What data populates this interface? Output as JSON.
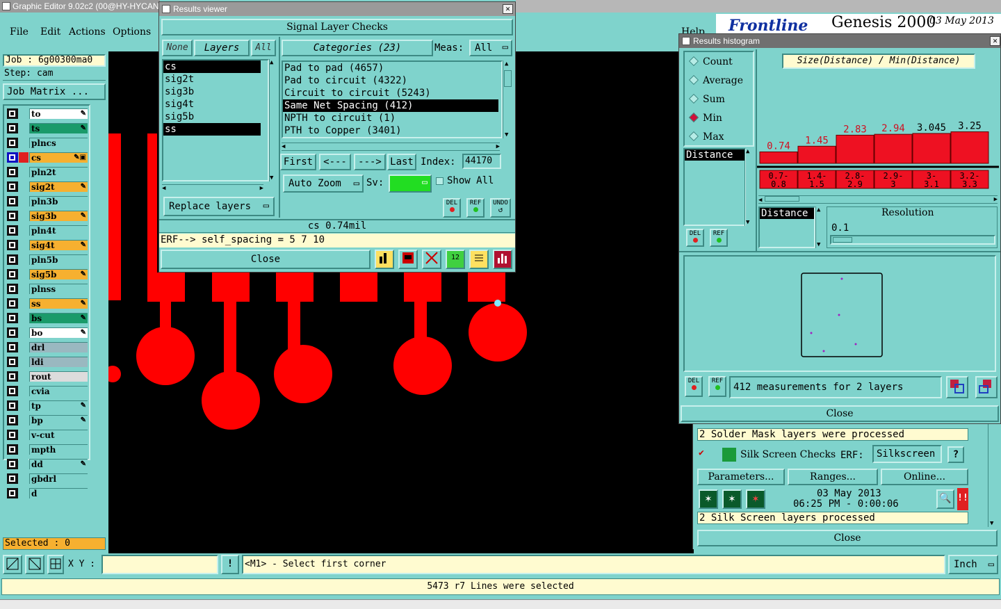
{
  "app": {
    "title": "Graphic Editor 9.02c2 (00@HY-HYCAN"
  },
  "menu": {
    "file": "File",
    "edit": "Edit",
    "actions": "Actions",
    "options": "Options"
  },
  "job": {
    "job_label": "Job : 6g00300ma0",
    "step_label": "Step: cam",
    "matrix_button": "Job Matrix ..."
  },
  "layers": [
    {
      "name": "to",
      "color": "#ffffff",
      "edit": true
    },
    {
      "name": "ts",
      "color": "#1a9a6a",
      "edit": true
    },
    {
      "name": "plncs",
      "color": "#7fd3cc",
      "edit": false
    },
    {
      "name": "cs",
      "color": "#f6b030",
      "edit": true,
      "active": true
    },
    {
      "name": "pln2t",
      "color": "#7fd3cc",
      "edit": false
    },
    {
      "name": "sig2t",
      "color": "#f6b030",
      "edit": true
    },
    {
      "name": "pln3b",
      "color": "#7fd3cc",
      "edit": false
    },
    {
      "name": "sig3b",
      "color": "#f6b030",
      "edit": true
    },
    {
      "name": "pln4t",
      "color": "#7fd3cc",
      "edit": false
    },
    {
      "name": "sig4t",
      "color": "#f6b030",
      "edit": true
    },
    {
      "name": "pln5b",
      "color": "#7fd3cc",
      "edit": false
    },
    {
      "name": "sig5b",
      "color": "#f6b030",
      "edit": true
    },
    {
      "name": "plnss",
      "color": "#7fd3cc",
      "edit": false
    },
    {
      "name": "ss",
      "color": "#f6b030",
      "edit": true
    },
    {
      "name": "bs",
      "color": "#1a9a6a",
      "edit": true
    },
    {
      "name": "bo",
      "color": "#ffffff",
      "edit": true
    },
    {
      "name": "drl",
      "color": "#9ab8c0",
      "edit": false
    },
    {
      "name": "ldi",
      "color": "#9ab8c0",
      "edit": false
    },
    {
      "name": "rout",
      "color": "#dcdcdc",
      "edit": false
    },
    {
      "name": "cvia",
      "color": "#7fd3cc",
      "edit": false
    },
    {
      "name": "tp",
      "color": "#7fd3cc",
      "edit": true
    },
    {
      "name": "bp",
      "color": "#7fd3cc",
      "edit": true
    },
    {
      "name": "v-cut",
      "color": "#7fd3cc",
      "edit": false
    },
    {
      "name": "mpth",
      "color": "#7fd3cc",
      "edit": false
    },
    {
      "name": "dd",
      "color": "#7fd3cc",
      "edit": true
    },
    {
      "name": "gbdrl",
      "color": "#7fd3cc",
      "edit": false
    },
    {
      "name": "d",
      "color": "#7fd3cc",
      "edit": false
    }
  ],
  "selected_label": "Selected : 0",
  "results_viewer": {
    "title": "Results viewer",
    "header": "Signal Layer Checks",
    "none_btn": "None",
    "layers_btn": "Layers",
    "all_btn": "All",
    "layer_list": [
      "cs",
      "sig2t",
      "sig3b",
      "sig4t",
      "sig5b",
      "ss"
    ],
    "categories_label": "Categories (23)",
    "meas_label": "Meas:",
    "meas_value": "All",
    "categories": [
      "Pad to pad (4657)",
      "Pad to circuit (4322)",
      "Circuit to circuit (5243)",
      "Same Net Spacing (412)",
      "NPTH to circuit (1)",
      "PTH to Copper (3401)"
    ],
    "first_btn": "First",
    "prev_btn": "<---",
    "next_btn": "--->",
    "last_btn": "Last",
    "index_label": "Index:",
    "index_value": "44170",
    "auto_zoom": "Auto Zoom",
    "sv_label": "Sv:",
    "show_all": "Show All",
    "replace_layers": "Replace layers",
    "del_lbl": "DEL",
    "ref_lbl": "REF",
    "undo_lbl": "UNDO",
    "status": "cs 0.74mil",
    "erf_line": "ERF--> self_spacing = 5 7 10",
    "close": "Close"
  },
  "genesis": {
    "brand": "Frontline",
    "product": "Genesis 2000",
    "date": "03 May 2013",
    "help": "Help"
  },
  "histogram": {
    "title": "Results histogram",
    "modes": [
      "Count",
      "Average",
      "Sum",
      "Min",
      "Max"
    ],
    "selected_mode": "Min",
    "expression": "Size(Distance) / Min(Distance)",
    "param_list_item": "Distance",
    "bars": [
      {
        "value": "0.74",
        "range": "0.7-0.8",
        "v": 0.74
      },
      {
        "value": "1.45",
        "range": "1.4-1.5",
        "v": 1.45
      },
      {
        "value": "2.83",
        "range": "2.8-2.9",
        "v": 2.83
      },
      {
        "value": "2.94",
        "range": "2.9-3",
        "v": 2.94
      },
      {
        "value": "3.045",
        "range": "3-3.1",
        "v": 3.045
      },
      {
        "value": "3.25",
        "range": "3.2-3.3",
        "v": 3.25
      }
    ],
    "resolution_param": "Distance",
    "resolution_label": "Resolution",
    "resolution_value": "0.1",
    "measurements": "412 measurements for 2 layers",
    "close": "Close"
  },
  "checklist": {
    "solder_mask_msg": "2 Solder Mask layers were processed",
    "silk_title": "Silk Screen Checks",
    "erf_label": "ERF:",
    "erf_value": "Silkscreen",
    "help_q": "?",
    "parameters": "Parameters...",
    "ranges": "Ranges...",
    "online": "Online...",
    "run_date": "03 May 2013",
    "run_time": "06:25 PM - 0:00:06",
    "silk_msg": "2 Silk Screen layers processed",
    "close": "Close"
  },
  "bottom": {
    "xy_label": "X Y :",
    "xy_value": "",
    "prompt": "<M1> - Select first corner",
    "units": "Inch",
    "status": "5473 r7 Lines were selected"
  }
}
